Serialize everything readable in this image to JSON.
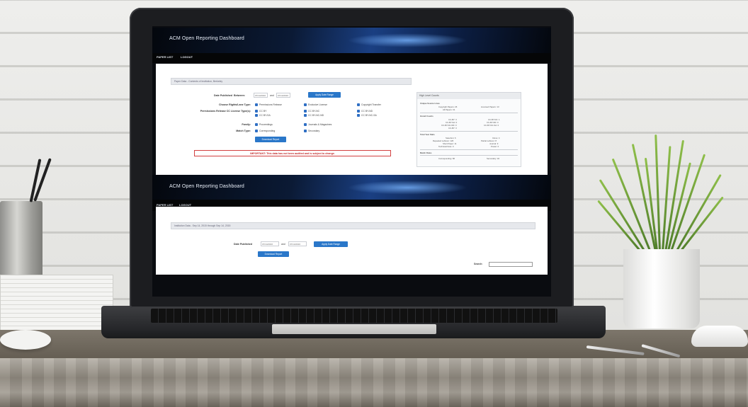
{
  "dashboard_top": {
    "banner_title": "ACM Open Reporting Dashboard",
    "nav": [
      "PAPER LIST",
      "LOGOUT"
    ],
    "section_title": "Paper Data - Contents of Institution, Berkeley",
    "filters": {
      "date_published_label": "Date Published",
      "between_label": "Between:",
      "date_from": "07/14/2016",
      "and_label": "and",
      "date_to": "07/14/2016",
      "apply_button": "Apply Date Range",
      "rights_label": "Choose Rights/Lane Type:",
      "rights_options": [
        "Permissions Release",
        "Exclusive License",
        "Copyright Transfer"
      ],
      "license_label": "Permissions Release CC License Type(s):",
      "license_col1": [
        "CC BY",
        "CC BY-SA"
      ],
      "license_col2": [
        "CC BY-NC",
        "CC BY-NC-ND"
      ],
      "license_col3": [
        "CC BY-ND",
        "CC BY-NC-SA"
      ],
      "family_label": "Family:",
      "family_options": [
        "Proceedings",
        "Journals & Magazines"
      ],
      "match_label": "Match Type:",
      "match_options": [
        "Corresponding",
        "Secondary"
      ],
      "download_button": "Download Report"
    },
    "warning": "IMPORTANT: This data has not been audited and is subject to change.",
    "side_panel": {
      "title": "High Level Counts",
      "sections": [
        {
          "label": "Unique Source Lines",
          "rows": [
            "Copyright Papers: 26",
            "Licensed Papers: 13",
            "All Papers: 31"
          ]
        },
        {
          "label": "Grand Counts",
          "rows": [
            "CC-BY: 3",
            "CC-BY-NC: 1",
            "CC-BY-SA: 0",
            "CC-BY-ND: 0",
            "CC-BY-NC-ND: 0",
            "CC-BY-NC-SA: 0",
            "CC-BY: 3"
          ]
        },
        {
          "label": "Total Year Stats",
          "rows": [
            "Selection: 6",
            "Clone: 4",
            "Repeated Leftover: 126",
            "Partial Leftover: 8",
            "Short Paper: 11",
            "Journal: 9",
            "Technical Note: 0",
            "Poster: 0"
          ]
        },
        {
          "label": "Match Rules",
          "rows": [
            "Corresponding: 86",
            "Secondary: 46"
          ]
        }
      ]
    }
  },
  "dashboard_bottom": {
    "banner_title": "ACM Open Reporting Dashboard",
    "nav": [
      "PAPER LIST",
      "LOGOUT"
    ],
    "section_title": "Institution Data - Sep 14, 2015 through Sep 14, 2015",
    "date_published_label": "Date Published",
    "date_from": "07/14/2016",
    "and_label": "and",
    "date_to": "07/14/2016",
    "apply_button": "Apply Date Range",
    "download_button": "Download Report",
    "search_label": "Search:"
  },
  "colors": {
    "button_blue": "#2a77c9",
    "warning_red": "#d24141",
    "banner_blue": "#1a3f82",
    "checkbox_blue": "#2f6fc4"
  }
}
